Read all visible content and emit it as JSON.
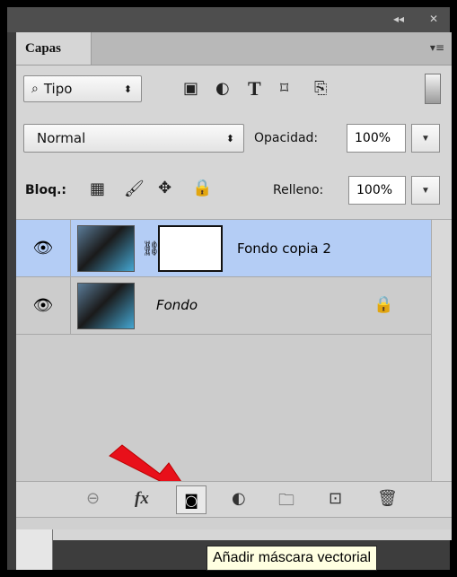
{
  "window": {
    "collapse_glyph": "◂◂",
    "close_glyph": "✕"
  },
  "panel": {
    "tab_label": "Capas",
    "menu_glyph": "▾≡"
  },
  "filter": {
    "kind_label": "Tipo",
    "icons": [
      "image-filter-icon",
      "adjustment-filter-icon",
      "type-filter-icon",
      "shape-filter-icon",
      "smart-object-filter-icon"
    ]
  },
  "blend": {
    "mode": "Normal",
    "opacity_label": "Opacidad:",
    "opacity_value": "100%"
  },
  "lock": {
    "label": "Bloq.:",
    "fill_label": "Relleno:",
    "fill_value": "100%"
  },
  "layers": [
    {
      "name": "Fondo copia 2",
      "selected": true,
      "has_mask": true,
      "locked": false
    },
    {
      "name": "Fondo",
      "selected": false,
      "has_mask": false,
      "locked": true
    }
  ],
  "bottom_icons": [
    "link-layers-icon",
    "fx-icon",
    "add-mask-icon",
    "adjustment-layer-icon",
    "new-group-icon",
    "new-layer-icon",
    "delete-layer-icon"
  ],
  "fx_label": "fx",
  "tooltip": "Añadir máscara vectorial",
  "colors": {
    "selected_row": "#b4cdf5",
    "panel_bg": "#d6d6d6",
    "arrow": "#e8101a"
  }
}
